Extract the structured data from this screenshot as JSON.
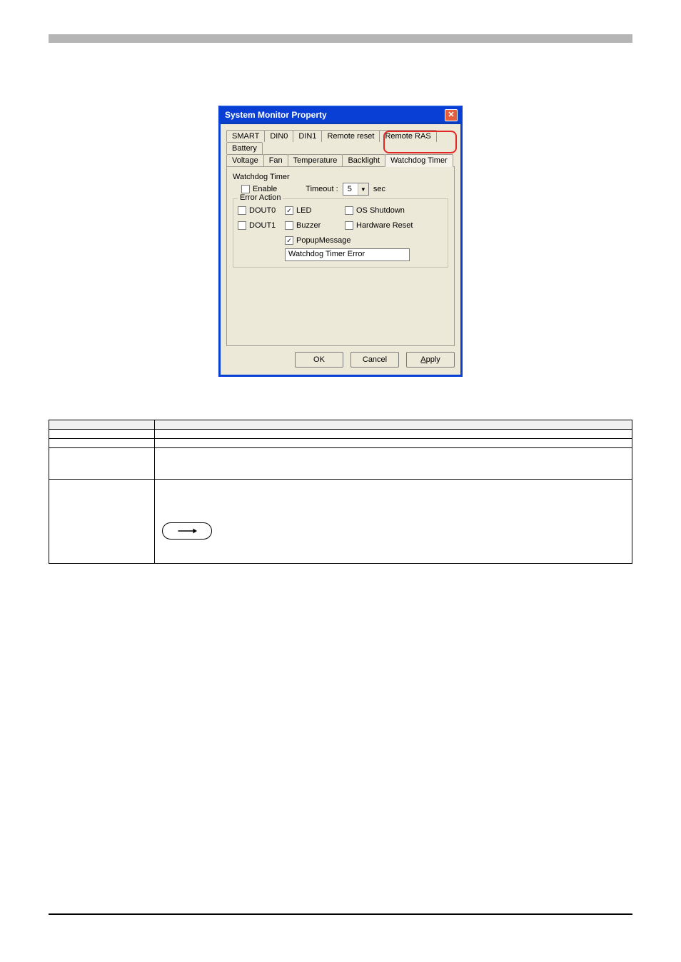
{
  "dialog": {
    "title": "System Monitor Property",
    "tabs_row1": [
      "SMART",
      "DIN0",
      "DIN1",
      "Remote reset",
      "Remote RAS",
      "Battery"
    ],
    "tabs_row2": [
      "Voltage",
      "Fan",
      "Temperature",
      "Backlight",
      "Watchdog Timer"
    ],
    "wdt_group": "Watchdog Timer",
    "enable": "Enable",
    "timeout_label": "Timeout :",
    "timeout_value": "5",
    "timeout_unit": "sec",
    "error_action": "Error Action",
    "opt_dout0": "DOUT0",
    "opt_dout1": "DOUT1",
    "opt_led": "LED",
    "opt_buzzer": "Buzzer",
    "opt_osshutdown": "OS Shutdown",
    "opt_hwreset": "Hardware Reset",
    "opt_popup": "PopupMessage",
    "popup_text": "Watchdog Timer Error",
    "btn_ok": "OK",
    "btn_cancel": "Cancel",
    "btn_apply_u": "A",
    "btn_apply_rest": "pply"
  },
  "table": {
    "hdr_item": "",
    "hdr_desc": "",
    "rows": [
      {
        "item": "",
        "desc": ""
      },
      {
        "item": "",
        "desc": ""
      },
      {
        "item": "",
        "desc": ""
      },
      {
        "item": "",
        "desc": ""
      }
    ]
  }
}
